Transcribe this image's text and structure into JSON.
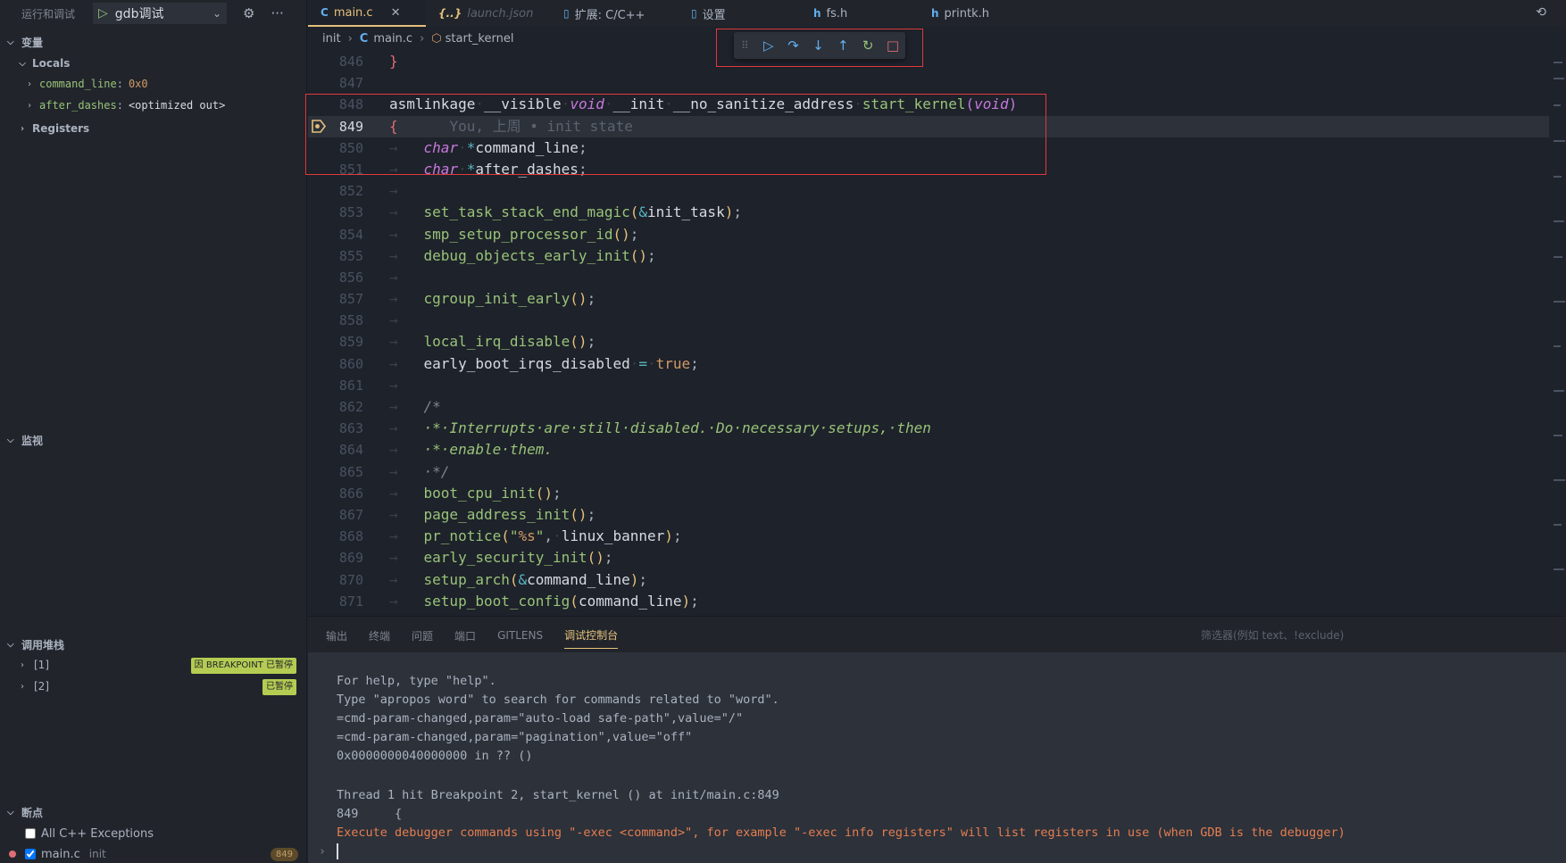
{
  "sidebar": {
    "title": "运行和调试",
    "launch_config": "gdb调试",
    "variables_label": "变量",
    "locals_label": "Locals",
    "locals": [
      {
        "name": "command_line",
        "sep": ":",
        "value": "0x0"
      },
      {
        "name": "after_dashes",
        "sep": ":",
        "value": "<optimized out>"
      }
    ],
    "registers_label": "Registers",
    "watch_label": "监视",
    "callstack_label": "调用堆栈",
    "callstack": [
      {
        "label": "[1]",
        "badge": "因 BREAKPOINT 已暂停"
      },
      {
        "label": "[2]",
        "badge": "已暂停"
      }
    ],
    "breakpoints_label": "断点",
    "breakpoints": [
      {
        "label": "All C++ Exceptions",
        "checked": false
      },
      {
        "label": "main.c",
        "detail": "init",
        "line": "849",
        "checked": true
      }
    ]
  },
  "tabs": [
    {
      "label": "main.c",
      "icon": "C",
      "icon_type": "c",
      "active": true
    },
    {
      "label": "launch.json",
      "icon": "{..}",
      "icon_type": "json",
      "active": false
    },
    {
      "label": "扩展: C/C++",
      "icon": "▯",
      "icon_type": "doc",
      "active": false
    },
    {
      "label": "设置",
      "icon": "▯",
      "icon_type": "doc",
      "active": false
    },
    {
      "label": "fs.h",
      "icon": "h",
      "icon_type": "h",
      "active": false
    },
    {
      "label": "printk.h",
      "icon": "h",
      "icon_type": "h",
      "active": false
    }
  ],
  "breadcrumb": {
    "folder": "init",
    "file": "main.c",
    "symbol": "start_kernel"
  },
  "editor": {
    "current_line": "849",
    "blame": "You, 上周 • init state",
    "line_numbers": [
      "846",
      "847",
      "848",
      "849",
      "850",
      "851",
      "852",
      "853",
      "854",
      "855",
      "856",
      "857",
      "858",
      "859",
      "860",
      "861",
      "862",
      "863",
      "864",
      "865",
      "866",
      "867",
      "868",
      "869",
      "870",
      "871"
    ]
  },
  "panel": {
    "tabs": [
      "输出",
      "终端",
      "问题",
      "端口",
      "GITLENS",
      "调试控制台"
    ],
    "active_tab": "调试控制台",
    "filter_placeholder": "筛选器(例如 text、!exclude)",
    "console_lines": [
      "For help, type \"help\".",
      "Type \"apropos word\" to search for commands related to \"word\".",
      "=cmd-param-changed,param=\"auto-load safe-path\",value=\"/\"",
      "=cmd-param-changed,param=\"pagination\",value=\"off\"",
      "0x0000000040000000 in ?? ()",
      "Thread 1 hit Breakpoint 2, start_kernel () at init/main.c:849",
      "849     {",
      "Execute debugger commands using \"-exec <command>\", for example \"-exec info registers\" will list registers in use (when GDB is the debugger)"
    ]
  },
  "colors": {
    "accent": "#e5c07b",
    "breakpoint": "#e06c75",
    "highlight_box": "#e0393e"
  }
}
